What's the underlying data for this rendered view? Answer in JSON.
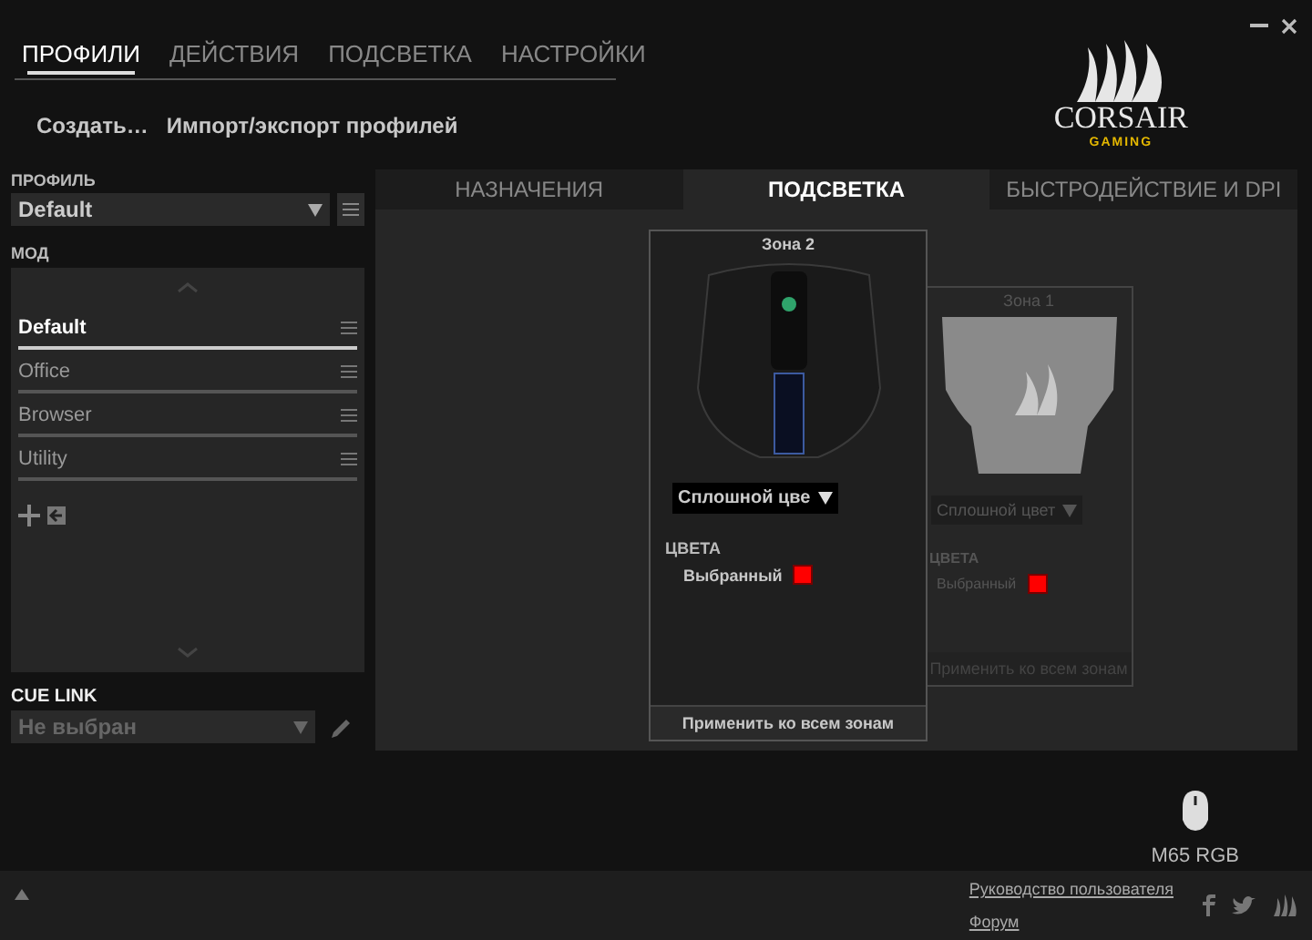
{
  "logo": {
    "brand": "CORSAIR",
    "tagline": "GAMING"
  },
  "main_tabs": [
    {
      "label": "ПРОФИЛИ",
      "selected": true
    },
    {
      "label": "ДЕЙСТВИЯ",
      "selected": false
    },
    {
      "label": "ПОДСВЕТКА",
      "selected": false
    },
    {
      "label": "НАСТРОЙКИ",
      "selected": false
    }
  ],
  "profile_actions": [
    "Создать…",
    "Импорт/экспорт профилей"
  ],
  "profile": {
    "label": "ПРОФИЛЬ",
    "value": "Default"
  },
  "modes": {
    "label": "МОД",
    "items": [
      {
        "name": "Default",
        "selected": true
      },
      {
        "name": "Office",
        "selected": false
      },
      {
        "name": "Browser",
        "selected": false
      },
      {
        "name": "Utility",
        "selected": false
      }
    ]
  },
  "cue_link": {
    "label": "CUE LINK",
    "value": "Не выбран"
  },
  "device_tabs": [
    {
      "label": "НАЗНАЧЕНИЯ",
      "selected": false
    },
    {
      "label": "ПОДСВЕТКА",
      "selected": true
    },
    {
      "label": "БЫСТРОДЕЙСТВИЕ И DPI",
      "selected": false
    }
  ],
  "zones": [
    {
      "title": "Зона 2",
      "active": true,
      "effect": "Сплошной цве",
      "colors_label": "ЦВЕТА",
      "color_label": "Выбранный",
      "color": "#ff0000",
      "apply": "Применить ко всем зонам"
    },
    {
      "title": "Зона 1",
      "active": false,
      "effect": "Сплошной цвет",
      "colors_label": "ЦВЕТА",
      "color_label": "Выбранный",
      "color": "#ff0000",
      "apply": "Применить ко всем зонам"
    }
  ],
  "device": {
    "name": "M65 RGB"
  },
  "footer": {
    "links": [
      "Руководство пользователя",
      "Форум"
    ]
  }
}
